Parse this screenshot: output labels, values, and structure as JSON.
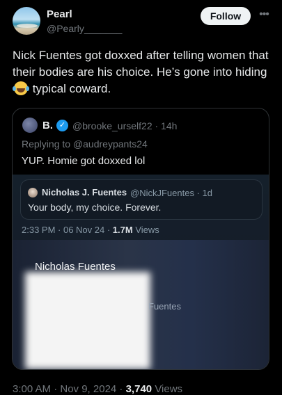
{
  "author": {
    "name": "Pearl",
    "handle": "@Pearly_______",
    "follow_label": "Follow",
    "more_icon": "more-horizontal-icon"
  },
  "tweet": {
    "text_part1": "Nick Fuentes got doxxed after telling women that their bodies are his choice. He’s gone into hiding",
    "emoji": "face-with-tears-of-joy",
    "text_part2": "typical coward."
  },
  "quote": {
    "name": "B.",
    "handle_time": "@brooke_urself22 · 14h",
    "replying_prefix": "Replying to",
    "replying_handle": "@audreypants24",
    "text": "YUP. Homie got doxxed lol",
    "screenshot": {
      "inner_name": "Nicholas J. Fuentes",
      "inner_handle_time": "@NickJFuentes · 1d",
      "inner_text": "Your body, my choice. Forever.",
      "meta_time": "2:33 PM · 06 Nov 24 ·",
      "meta_views_count": "1.7M",
      "meta_views_label": "Views",
      "photo_name": "Nicholas Fuentes",
      "photo_caption": "Fuentes"
    }
  },
  "footer": {
    "time": "3:00 AM · Nov 9, 2024 ·",
    "views_count": "3,740",
    "views_label": "Views"
  },
  "colors": {
    "background": "#000000",
    "text": "#e7e9ea",
    "muted": "#71767b",
    "verified": "#1d9bf0",
    "follow_bg": "#eff3f4"
  }
}
